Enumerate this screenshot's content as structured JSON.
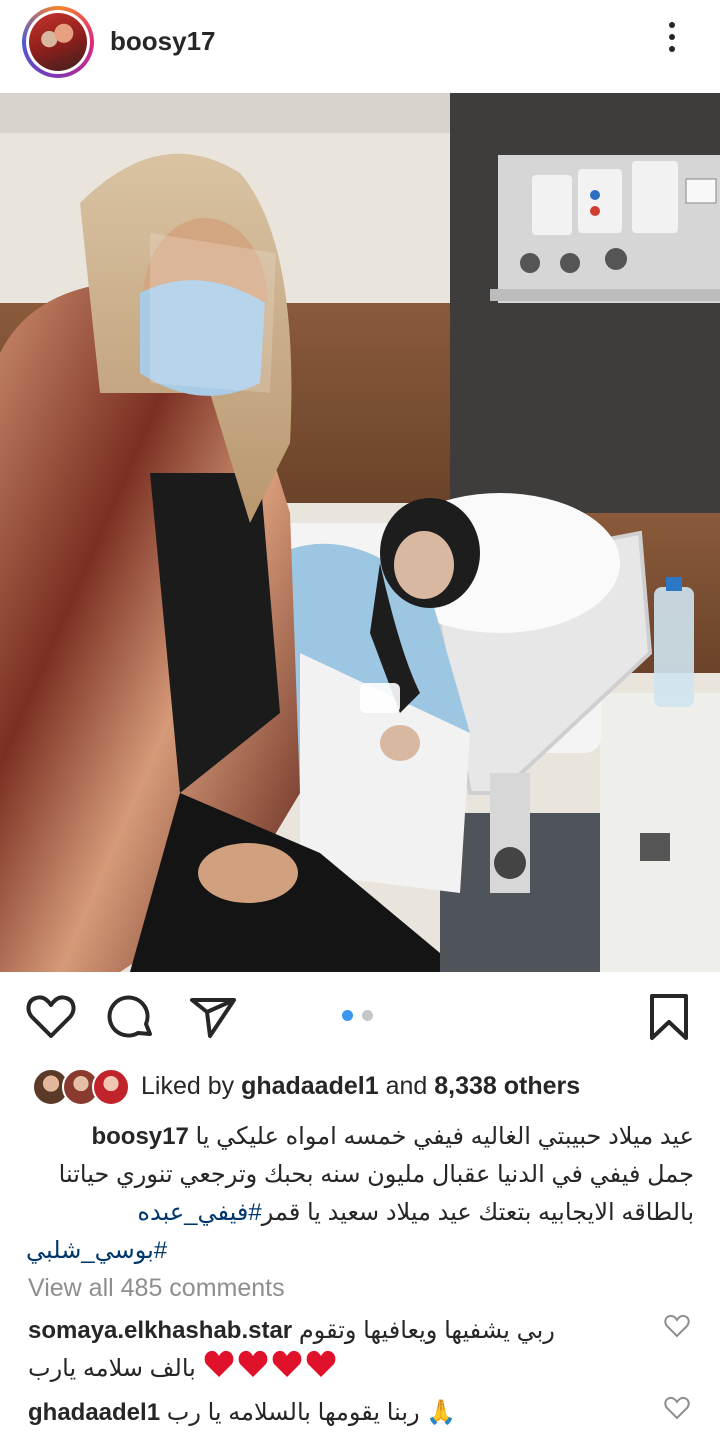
{
  "post": {
    "username": "boosy17",
    "more_icon": "more-vertical-icon"
  },
  "actions": {
    "like_icon": "heart-icon",
    "comment_icon": "comment-icon",
    "share_icon": "send-icon",
    "save_icon": "bookmark-icon",
    "carousel_active": 1,
    "carousel_count": 2,
    "active_dot_color": "#3897f0"
  },
  "likes": {
    "prefix": "Liked by ",
    "user": "ghadaadel1",
    "middle": " and ",
    "count": "8,338 others"
  },
  "caption": {
    "username": "boosy17",
    "line1": "عيد ميلاد حبيبتي الغاليه فيفي خمسه امواه عليكي يا",
    "line2": "جمل فيفي في الدنيا عقبال مليون سنه بحبك وترجعي تنوري حياتنا",
    "line3_text": "بالطاقه الايجابيه بتعتك  عيد ميلاد سعيد يا قمر",
    "line3_tag": "#فيفي_عبده",
    "line4_tag": "#بوسي_شلبي"
  },
  "view_all_comments": "View all 485 comments",
  "comments": [
    {
      "username": "somaya.elkhashab.star",
      "text": "ربي يشفيها ويعافيها وتقوم",
      "line2": "بالف سلامه يارب",
      "hearts": 4,
      "heart_color": "#e0112b"
    },
    {
      "username": "ghadaadel1",
      "text": "ربنا يقومها بالسلامه يا رب",
      "emoji": "🙏"
    }
  ]
}
